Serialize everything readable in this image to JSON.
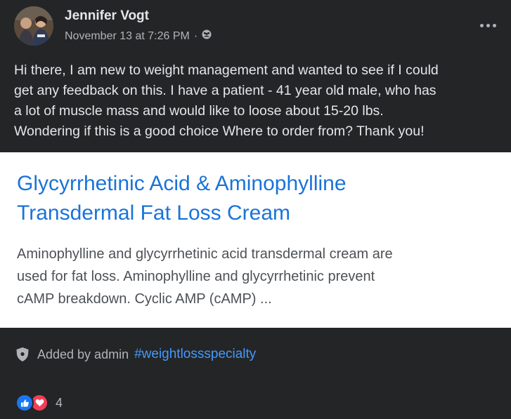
{
  "post": {
    "author": "Jennifer Vogt",
    "timestamp": "November 13 at 7:26 PM",
    "separator": "·",
    "audience_icon": "group-audience-icon",
    "more_icon": "more-options-icon",
    "text_lines": [
      "Hi there, I am new to weight management and wanted to see if I could",
      "get any feedback on this. I have a patient - 41 year old male, who has",
      "a lot of muscle mass and would like to loose about 15-20 lbs.",
      "Wondering if this is a good choice Where to order from?  Thank you!"
    ]
  },
  "link_card": {
    "title_lines": [
      "Glycyrrhetinic Acid & Aminophylline",
      "Transdermal Fat Loss Cream"
    ],
    "description_lines": [
      "Aminophylline and glycyrrhetinic acid transdermal cream are",
      "used for fat loss. Aminophylline and glycyrrhetinic prevent",
      "cAMP breakdown. Cyclic AMP (cAMP) ..."
    ]
  },
  "topic": {
    "icon": "admin-shield-icon",
    "added_by": "Added by admin",
    "hashtag": "#weightlossspecialty"
  },
  "reactions": {
    "icons": [
      "like-icon",
      "love-icon"
    ],
    "count": "4"
  },
  "colors": {
    "background": "#242526",
    "link_title": "#1a73d8",
    "hashtag": "#4599ff",
    "like": "#1877f2",
    "love": "#f33e58"
  }
}
